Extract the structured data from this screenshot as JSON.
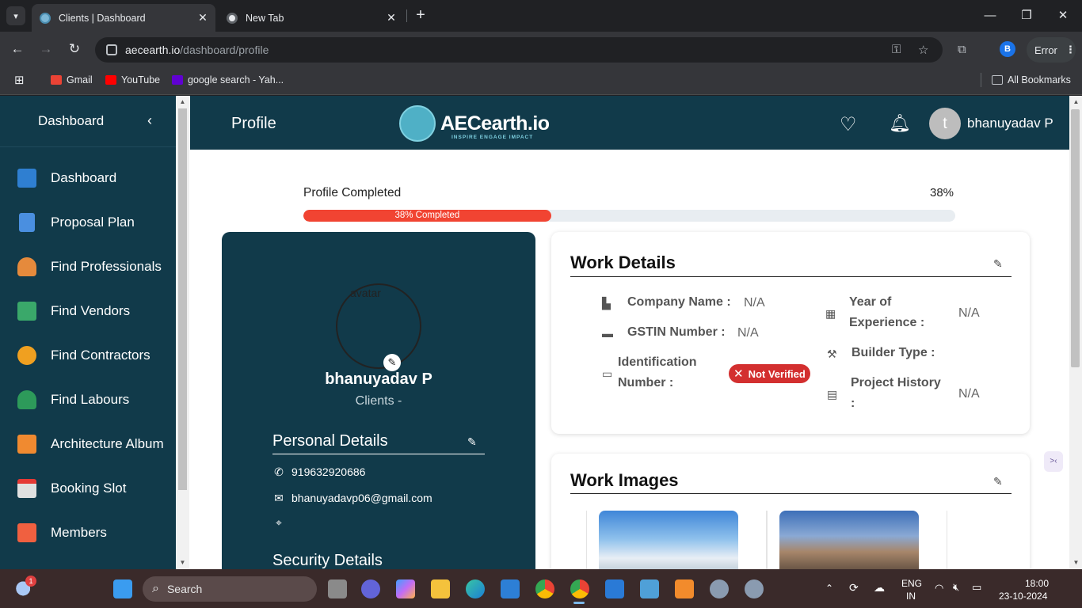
{
  "browser": {
    "tabs": [
      {
        "title": "Clients | Dashboard",
        "active": true
      },
      {
        "title": "New Tab",
        "active": false
      }
    ],
    "url_host": "aecearth.io",
    "url_path": "/dashboard/profile",
    "profile_initial": "B",
    "error_label": "Error",
    "bookmarks": [
      {
        "label": "Gmail"
      },
      {
        "label": "YouTube"
      },
      {
        "label": "google search - Yah..."
      }
    ],
    "all_bookmarks": "All Bookmarks"
  },
  "sidebar": {
    "title": "Dashboard",
    "items": [
      {
        "label": "Dashboard",
        "icon": "dashboard-icon",
        "color": "#2f7fd1"
      },
      {
        "label": "Proposal Plan",
        "icon": "document-icon",
        "color": "#4a8fe0"
      },
      {
        "label": "Find Professionals",
        "icon": "professional-icon",
        "color": "#e58a3c"
      },
      {
        "label": "Find Vendors",
        "icon": "store-icon",
        "color": "#3aa86a"
      },
      {
        "label": "Find Contractors",
        "icon": "contractor-gear-icon",
        "color": "#f0a020"
      },
      {
        "label": "Find Labours",
        "icon": "labour-icon",
        "color": "#2d9a5a"
      },
      {
        "label": "Architecture Album",
        "icon": "album-icon",
        "color": "#f08a30"
      },
      {
        "label": "Booking Slot",
        "icon": "calendar-icon",
        "color": "#e0e0e0"
      },
      {
        "label": "Members",
        "icon": "members-icon",
        "color": "#f06040"
      }
    ]
  },
  "header": {
    "title": "Profile",
    "logo_text": "AECearth.io",
    "logo_tagline": "INSPIRE ENGAGE IMPACT",
    "avatar_initial": "t",
    "username": "bhanuyadav P"
  },
  "progress": {
    "label": "Profile Completed",
    "percent_text": "38%",
    "fill_text": "38% Completed",
    "value": 38
  },
  "profile_card": {
    "avatar_alt": "avatar",
    "name": "bhanuyadav P",
    "role": "Clients -",
    "personal_title": "Personal Details",
    "phone": "919632920686",
    "email": "bhanuyadavp06@gmail.com",
    "location": "",
    "security_title": "Security Details"
  },
  "work_details": {
    "title": "Work Details",
    "company_label": "Company Name :",
    "company_value": "N/A",
    "gstin_label": "GSTIN Number :",
    "gstin_value": "N/A",
    "id_label_1": "Identification",
    "id_label_2": "Number :",
    "id_status": "Not Verified",
    "experience_label_1": "Year of",
    "experience_label_2": "Experience :",
    "experience_value": "N/A",
    "builder_label": "Builder Type :",
    "builder_value": "",
    "history_label_1": "Project History",
    "history_label_2": ":",
    "history_value": "N/A"
  },
  "work_images": {
    "title": "Work Images"
  },
  "taskbar": {
    "search_placeholder": "Search",
    "notification_count": "1",
    "language_1": "ENG",
    "language_2": "IN",
    "time": "18:00",
    "date": "23-10-2024"
  },
  "colors": {
    "primary": "#113a4a",
    "progress_fill": "#f14432",
    "badge_red": "#d32f2f"
  }
}
